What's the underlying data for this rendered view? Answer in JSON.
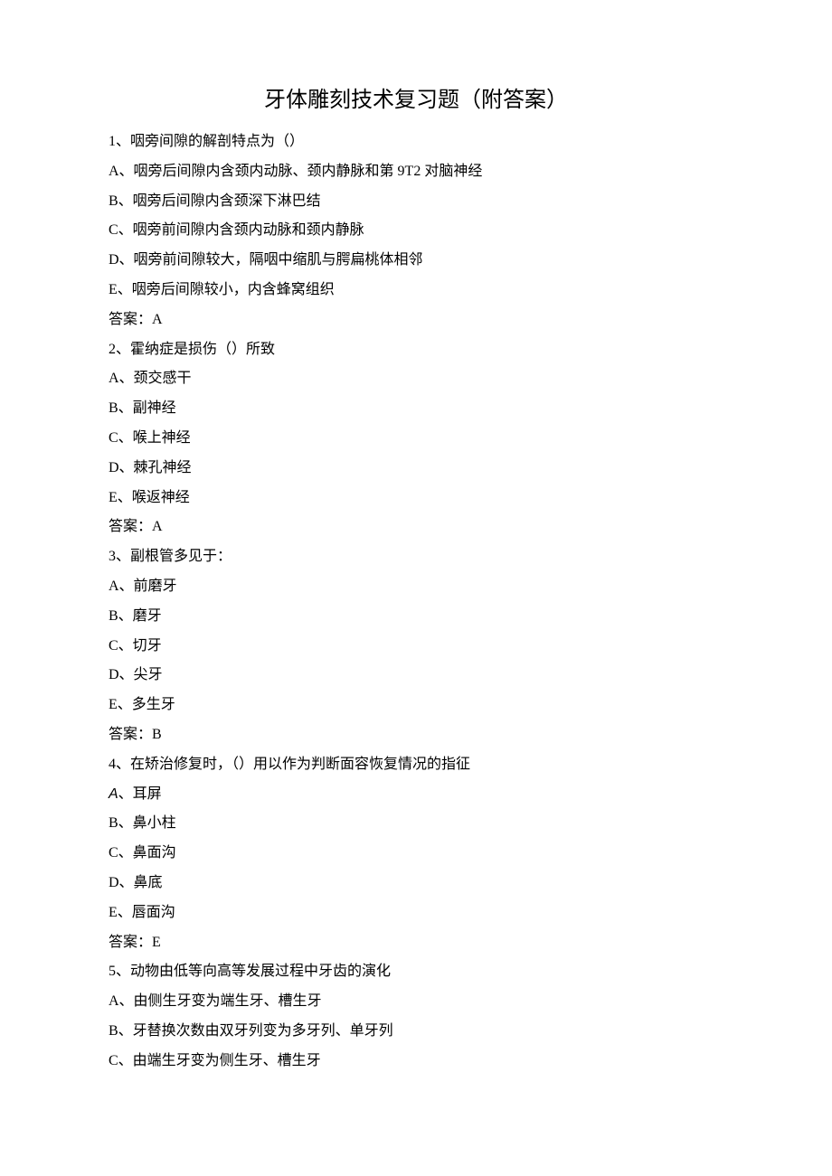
{
  "title": "牙体雕刻技术复习题（附答案）",
  "questions": [
    {
      "num": "1",
      "stem": "咽旁间隙的解剖特点为（）",
      "options": [
        "A、咽旁后间隙内含颈内动脉、颈内静脉和第 9T2 对脑神经",
        "B、咽旁后间隙内含颈深下淋巴结",
        "C、咽旁前间隙内含颈内动脉和颈内静脉",
        "D、咽旁前间隙较大，隔咽中缩肌与腭扁桃体相邻",
        "E、咽旁后间隙较小，内含蜂窝组织"
      ],
      "answer": "答案：A"
    },
    {
      "num": "2",
      "stem": "霍纳症是损伤（）所致",
      "options": [
        "A、颈交感干",
        "B、副神经",
        "C、喉上神经",
        "D、棘孔神经",
        "E、喉返神经"
      ],
      "answer": "答案：A"
    },
    {
      "num": "3",
      "stem": "副根管多见于：",
      "options": [
        "A、前磨牙",
        "B、磨牙",
        "C、切牙",
        "D、尖牙",
        "E、多生牙"
      ],
      "answer": "答案：B"
    },
    {
      "num": "4",
      "stem": "在矫治修复时，（）用以作为判断面容恢复情况的指征",
      "options_alt_first": true,
      "options": [
        "A、耳屏",
        "B、鼻小柱",
        "C、鼻面沟",
        "D、鼻底",
        "E、唇面沟"
      ],
      "answer": "答案：E"
    },
    {
      "num": "5",
      "stem": "动物由低等向高等发展过程中牙齿的演化",
      "options": [
        "A、由侧生牙变为端生牙、槽生牙",
        "B、牙替换次数由双牙列变为多牙列、单牙列",
        "C、由端生牙变为侧生牙、槽生牙"
      ],
      "answer": null
    }
  ]
}
